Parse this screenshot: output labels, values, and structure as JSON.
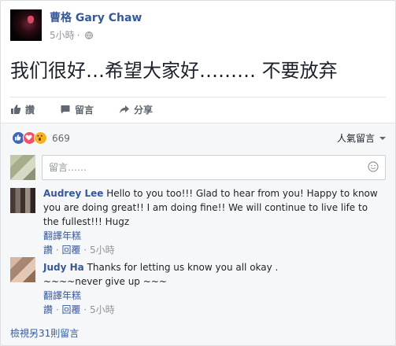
{
  "post": {
    "author": "曹格 Gary Chaw",
    "time": "5小時",
    "privacy_sep": "·",
    "text": "我们很好…希望大家好……… 不要放弃"
  },
  "actions": {
    "like": "讚",
    "comment": "留言",
    "share": "分享"
  },
  "reactions": {
    "count": "669",
    "icons": [
      "like-reaction-icon",
      "love-reaction-icon",
      "wow-reaction-icon"
    ]
  },
  "sort": {
    "label": "人氣留言"
  },
  "composer": {
    "placeholder": "留言……"
  },
  "comments": [
    {
      "name": "Audrey Lee",
      "text": "Hello to you too!!! Glad to hear from you! Happy to know you are doing great!! I am doing fine!! We will continue to live life to the fullest!!! Hugz",
      "translate": "翻譯年糕",
      "like": "讚",
      "reply": "回覆",
      "sep": "·",
      "time": "5小時"
    },
    {
      "name": "Judy Ha",
      "text": "Thanks for letting us know you all okay .",
      "text2": "~~~~never give up ~~~",
      "translate": "翻譯年糕",
      "like": "讚",
      "reply": "回覆",
      "sep": "·",
      "time": "5小時"
    }
  ],
  "more_comments": "檢視另31則留言",
  "colors": {
    "link": "#365899",
    "meta": "#90949c",
    "like_blue": "#4267b2",
    "love_red": "#f25268",
    "wow_yellow": "#f7b125"
  }
}
